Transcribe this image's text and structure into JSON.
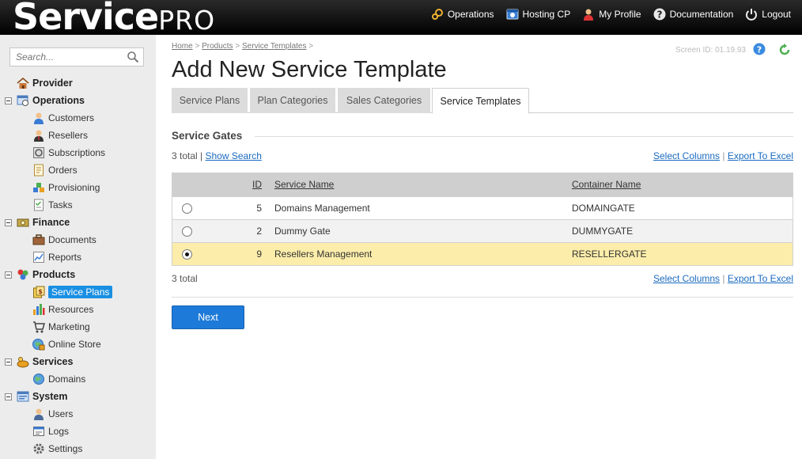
{
  "app": {
    "brand": "Service",
    "brand_suffix": "PRO"
  },
  "topnav": [
    {
      "label": "Operations",
      "icon": "gears-icon"
    },
    {
      "label": "Hosting CP",
      "icon": "hosting-cp-icon"
    },
    {
      "label": "My Profile",
      "icon": "profile-icon"
    },
    {
      "label": "Documentation",
      "icon": "help-icon"
    },
    {
      "label": "Logout",
      "icon": "power-icon"
    }
  ],
  "sidebar": {
    "search_placeholder": "Search...",
    "items": [
      {
        "label": "Provider",
        "type": "section",
        "icon": "home-icon"
      },
      {
        "label": "Operations",
        "type": "section",
        "icon": "operations-icon"
      },
      {
        "label": "Customers",
        "type": "item",
        "icon": "customer-icon"
      },
      {
        "label": "Resellers",
        "type": "item",
        "icon": "reseller-icon"
      },
      {
        "label": "Subscriptions",
        "type": "item",
        "icon": "subscriptions-icon"
      },
      {
        "label": "Orders",
        "type": "item",
        "icon": "orders-icon"
      },
      {
        "label": "Provisioning",
        "type": "item",
        "icon": "provisioning-icon"
      },
      {
        "label": "Tasks",
        "type": "item",
        "icon": "tasks-icon"
      },
      {
        "label": "Finance",
        "type": "section",
        "icon": "finance-icon"
      },
      {
        "label": "Documents",
        "type": "item",
        "icon": "documents-icon"
      },
      {
        "label": "Reports",
        "type": "item",
        "icon": "reports-icon"
      },
      {
        "label": "Products",
        "type": "section",
        "icon": "products-icon"
      },
      {
        "label": "Service Plans",
        "type": "item",
        "icon": "service-plans-icon",
        "active": true
      },
      {
        "label": "Resources",
        "type": "item",
        "icon": "resources-icon"
      },
      {
        "label": "Marketing",
        "type": "item",
        "icon": "marketing-icon"
      },
      {
        "label": "Online Store",
        "type": "item",
        "icon": "online-store-icon"
      },
      {
        "label": "Services",
        "type": "section",
        "icon": "services-icon"
      },
      {
        "label": "Domains",
        "type": "item",
        "icon": "domains-icon"
      },
      {
        "label": "System",
        "type": "section",
        "icon": "system-icon"
      },
      {
        "label": "Users",
        "type": "item",
        "icon": "users-icon"
      },
      {
        "label": "Logs",
        "type": "item",
        "icon": "logs-icon"
      },
      {
        "label": "Settings",
        "type": "item",
        "icon": "settings-icon"
      }
    ]
  },
  "breadcrumb": [
    "Home",
    "Products",
    "Service Templates"
  ],
  "screen_id": "Screen ID: 01.19.93",
  "page_title": "Add New Service Template",
  "tabs": [
    {
      "label": "Service Plans",
      "active": false
    },
    {
      "label": "Plan Categories",
      "active": false
    },
    {
      "label": "Sales Categories",
      "active": false
    },
    {
      "label": "Service Templates",
      "active": true
    }
  ],
  "section_title": "Service Gates",
  "list": {
    "total_text": "3 total",
    "show_search": "Show Search",
    "select_columns": "Select Columns",
    "export_excel": "Export To Excel",
    "columns": {
      "id": "ID",
      "service_name": "Service Name",
      "container_name": "Container Name"
    },
    "rows": [
      {
        "id": "5",
        "service_name": "Domains Management",
        "container_name": "DOMAINGATE",
        "selected": false
      },
      {
        "id": "2",
        "service_name": "Dummy Gate",
        "container_name": "DUMMYGATE",
        "selected": false
      },
      {
        "id": "9",
        "service_name": "Resellers Management",
        "container_name": "RESELLERGATE",
        "selected": true
      }
    ]
  },
  "next_button": "Next",
  "colors": {
    "accent": "#1d7ad8",
    "selected_row": "#fcedaa",
    "active_nav": "#1a8fe3"
  }
}
